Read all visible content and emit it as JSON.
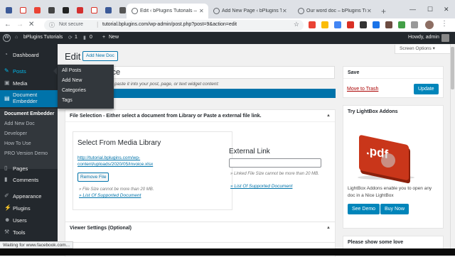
{
  "browser": {
    "tabs": [
      {
        "title": "Edit ‹ bPlugins Tutorials — WordPress"
      },
      {
        "title": "Add New Page ‹ bPlugins Tutorials"
      },
      {
        "title": "Our word doc – bPlugins Tutorials"
      }
    ],
    "address": {
      "security": "Not secure",
      "url": "tutorial.bplugins.com/wp-admin/post.php?post=9&action=edit"
    },
    "status_text": "Waiting for www.facebook.com..."
  },
  "adminbar": {
    "site_name": "bPlugins Tutorials",
    "updates": "1",
    "comments": "0",
    "new": "New",
    "howdy": "Howdy, admin"
  },
  "sidebar": {
    "items": [
      {
        "label": "Dashboard",
        "icon": "dashboard-icon"
      },
      {
        "label": "Posts",
        "icon": "pin-icon"
      },
      {
        "label": "Media",
        "icon": "media-icon"
      },
      {
        "label": "Document Embedder",
        "icon": "document-icon"
      },
      {
        "label": "Pages",
        "icon": "pages-icon"
      },
      {
        "label": "Comments",
        "icon": "comments-icon"
      },
      {
        "label": "Appearance",
        "icon": "brush-icon"
      },
      {
        "label": "Plugins",
        "icon": "plugin-icon"
      },
      {
        "label": "Users",
        "icon": "users-icon"
      },
      {
        "label": "Tools",
        "icon": "wrench-icon"
      }
    ],
    "submenu": [
      "Document Embedder",
      "Add New Doc",
      "Developer",
      "How To Use",
      "PRO Version Demo"
    ],
    "flyout": [
      "All Posts",
      "Add New",
      "Categories",
      "Tags"
    ]
  },
  "page": {
    "heading": "Edit",
    "add_new": "Add New Doc",
    "screen_options": "Screen Options ▾",
    "title_value": "ice",
    "hint": "paste it into your post, page, or text widget content:"
  },
  "file_selection": {
    "header": "File Selection - Either select a document from Library or Paste a external file link.",
    "library_heading": "Select From Media Library",
    "file_link": "http://tutorial.bplugins.com/wp-content/uploads/2020/05/invoice.xlsx",
    "remove_button": "Remove File",
    "note": "» File Size cannot be more than 20 MB.",
    "supported": "» List Of Supported Document",
    "external_heading": "External Link",
    "external_value": "",
    "external_note": "» Linked File Size cannot be more than 20 MB.",
    "external_supported": "» List Of Supported Document"
  },
  "viewer_settings": {
    "header": "Viewer Settings (Optional)"
  },
  "save_box": {
    "header": "Save",
    "trash": "Move to Trash",
    "update": "Update"
  },
  "lightbox_box": {
    "header": "Try LightBox Addons",
    "pdf_label": ".pdf",
    "desc": "LightBox Addons enable you to open any doc in a Nice LightBox",
    "see_demo": "See Demo",
    "buy_now": "Buy Now"
  },
  "love_box": {
    "header": "Please show some love"
  },
  "colors": {
    "wp_blue": "#0073aa",
    "admin_dark": "#23282d",
    "pdf_red": "#c9361a"
  }
}
